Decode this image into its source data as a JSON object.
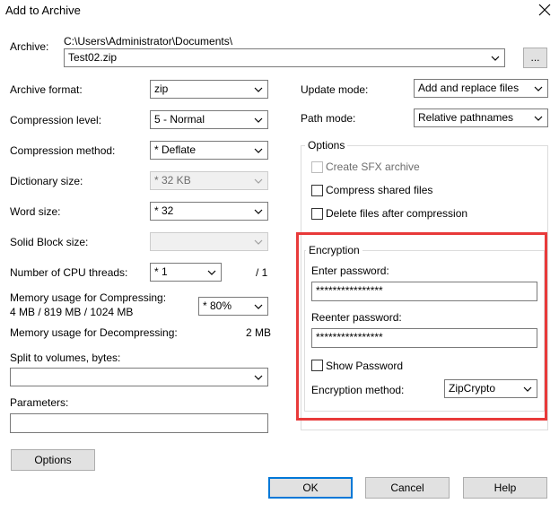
{
  "window": {
    "title": "Add to Archive"
  },
  "archive": {
    "label": "Archive:",
    "path": "C:\\Users\\Administrator\\Documents\\",
    "filename": "Test02.zip",
    "browse_label": "..."
  },
  "left": {
    "archive_format": {
      "label": "Archive format:",
      "value": "zip"
    },
    "compression_level": {
      "label": "Compression level:",
      "value": "5 - Normal"
    },
    "compression_method": {
      "label": "Compression method:",
      "value": "* Deflate"
    },
    "dictionary_size": {
      "label": "Dictionary size:",
      "value": "* 32 KB"
    },
    "word_size": {
      "label": "Word size:",
      "value": "* 32"
    },
    "solid_block_size": {
      "label": "Solid Block size:",
      "value": ""
    },
    "cpu_threads": {
      "label": "Number of CPU threads:",
      "value": "* 1",
      "max": "/ 1"
    },
    "memory_compress": {
      "label_line1": "Memory usage for Compressing:",
      "label_line2": "4 MB / 819 MB / 1024 MB",
      "value": "* 80%"
    },
    "memory_decompress": {
      "label": "Memory usage for Decompressing:",
      "value": "2 MB"
    },
    "split_volumes": {
      "label": "Split to volumes, bytes:",
      "value": ""
    },
    "parameters": {
      "label": "Parameters:",
      "value": ""
    },
    "options_button": "Options"
  },
  "right": {
    "update_mode": {
      "label": "Update mode:",
      "value": "Add and replace files"
    },
    "path_mode": {
      "label": "Path mode:",
      "value": "Relative pathnames"
    },
    "options_group": {
      "title": "Options",
      "create_sfx": "Create SFX archive",
      "compress_shared": "Compress shared files",
      "delete_after": "Delete files after compression"
    },
    "encryption_group": {
      "title": "Encryption",
      "enter_password_label": "Enter password:",
      "enter_password_value": "****************",
      "reenter_password_label": "Reenter password:",
      "reenter_password_value": "****************",
      "show_password": "Show Password",
      "method_label": "Encryption method:",
      "method_value": "ZipCrypto"
    }
  },
  "buttons": {
    "ok": "OK",
    "cancel": "Cancel",
    "help": "Help"
  },
  "colors": {
    "highlight": "#e83a3a",
    "default_button_border": "#0078d7"
  }
}
